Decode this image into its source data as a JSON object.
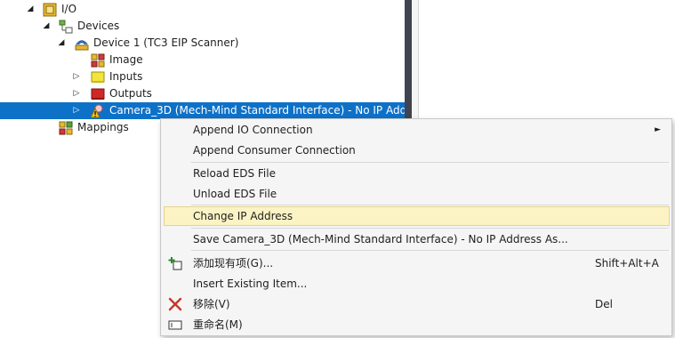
{
  "tree": {
    "io_label": "I/O",
    "devices_label": "Devices",
    "device1_label": "Device 1 (TC3 EIP Scanner)",
    "image_label": "Image",
    "inputs_label": "Inputs",
    "outputs_label": "Outputs",
    "camera_label": "Camera_3D (Mech-Mind Standard Interface) - No IP Add",
    "mappings_label": "Mappings",
    "expanded_glyph": "◢",
    "collapsed_glyph": "▷"
  },
  "context_menu": {
    "append_io": "Append IO Connection",
    "append_io_arrow": "►",
    "append_consumer": "Append Consumer Connection",
    "reload_eds": "Reload EDS File",
    "unload_eds": "Unload EDS File",
    "change_ip": "Change IP Address",
    "save_as": "Save Camera_3D (Mech-Mind Standard Interface) - No IP Address As...",
    "add_existing_cn": "添加现有项(G)...",
    "add_existing_shortcut": "Shift+Alt+A",
    "insert_existing": "Insert Existing Item...",
    "remove": "移除(V)",
    "remove_shortcut": "Del",
    "rename": "重命名(M)"
  },
  "colors": {
    "selection": "#0e71c8",
    "menu_hover": "#fcf3c4",
    "splitter": "#3f4450",
    "remove_icon": "#c0392b"
  }
}
